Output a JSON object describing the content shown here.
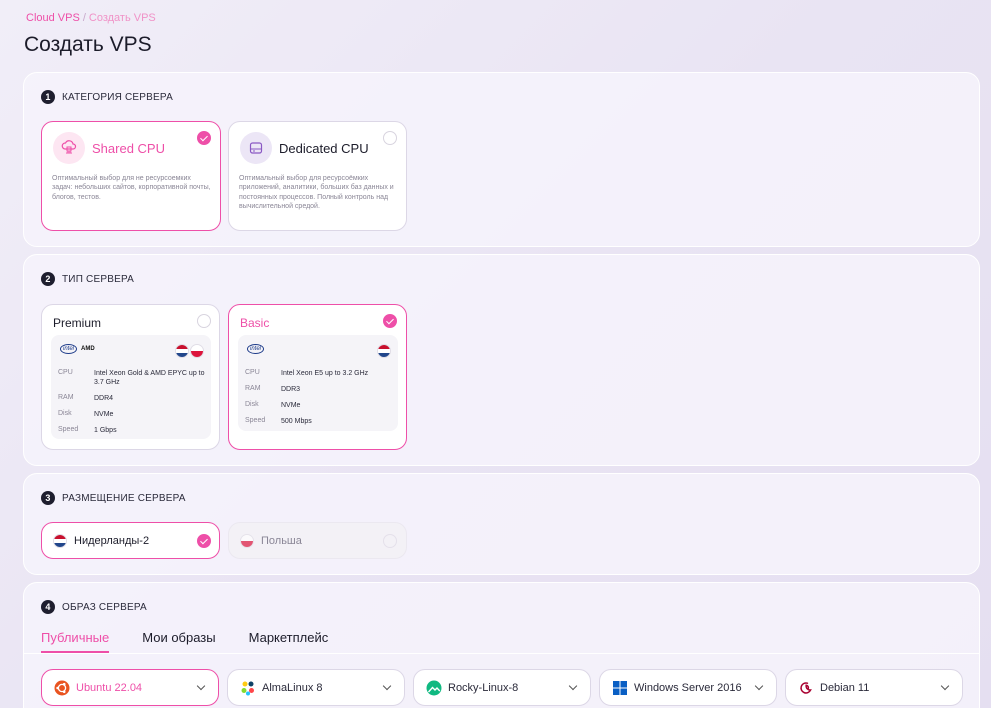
{
  "breadcrumb": {
    "root": "Cloud VPS",
    "separator": "/",
    "current": "Создать VPS"
  },
  "page_title": "Создать VPS",
  "sections": {
    "category": {
      "number": "1",
      "title": "КАТЕГОРИЯ СЕРВЕРА",
      "cards": [
        {
          "title": "Shared CPU",
          "desc": "Оптимальный выбор для не ресурсоемких задач: небольших сайтов, корпоративной почты, блогов, тестов.",
          "selected": true
        },
        {
          "title": "Dedicated CPU",
          "desc": "Оптимальный выбор для ресурсоёмких приложений, аналитики, больших баз данных и постоянных процессов. Полный контроль над вычислительной средой.",
          "selected": false
        }
      ]
    },
    "type": {
      "number": "2",
      "title": "ТИП СЕРВЕРА",
      "cards": [
        {
          "title": "Premium",
          "selected": false,
          "brands": [
            "intel",
            "AMD"
          ],
          "specs": [
            {
              "k": "CPU",
              "v": "Intel Xeon Gold & AMD EPYC up to 3.7 GHz"
            },
            {
              "k": "RAM",
              "v": "DDR4"
            },
            {
              "k": "Disk",
              "v": "NVMe"
            },
            {
              "k": "Speed",
              "v": "1 Gbps"
            }
          ]
        },
        {
          "title": "Basic",
          "selected": true,
          "brands": [
            "intel"
          ],
          "specs": [
            {
              "k": "CPU",
              "v": "Intel Xeon E5 up to 3.2 GHz"
            },
            {
              "k": "RAM",
              "v": "DDR3"
            },
            {
              "k": "Disk",
              "v": "NVMe"
            },
            {
              "k": "Speed",
              "v": "500 Mbps"
            }
          ]
        }
      ]
    },
    "location": {
      "number": "3",
      "title": "РАЗМЕЩЕНИЕ СЕРВЕРА",
      "options": [
        {
          "label": "Нидерланды-2",
          "selected": true
        },
        {
          "label": "Польша",
          "selected": false,
          "disabled": true
        }
      ]
    },
    "image": {
      "number": "4",
      "title": "ОБРАЗ СЕРВЕРА",
      "tabs": [
        "Публичные",
        "Мои образы",
        "Маркетплейс"
      ],
      "active_tab": "Публичные",
      "os": [
        {
          "label": "Ubuntu 22.04",
          "icon": "ubuntu-icon",
          "selected": true
        },
        {
          "label": "AlmaLinux 8",
          "icon": "almalinux-icon"
        },
        {
          "label": "Rocky-Linux-8",
          "icon": "rocky-linux-icon"
        },
        {
          "label": "Windows Server 2016",
          "icon": "windows-icon"
        },
        {
          "label": "Debian 11",
          "icon": "debian-icon"
        }
      ]
    }
  },
  "colors": {
    "accent": "#ee4fa8",
    "nl_red": "#c8102e",
    "nl_blue": "#21468b",
    "pl_red": "#dc143c"
  }
}
